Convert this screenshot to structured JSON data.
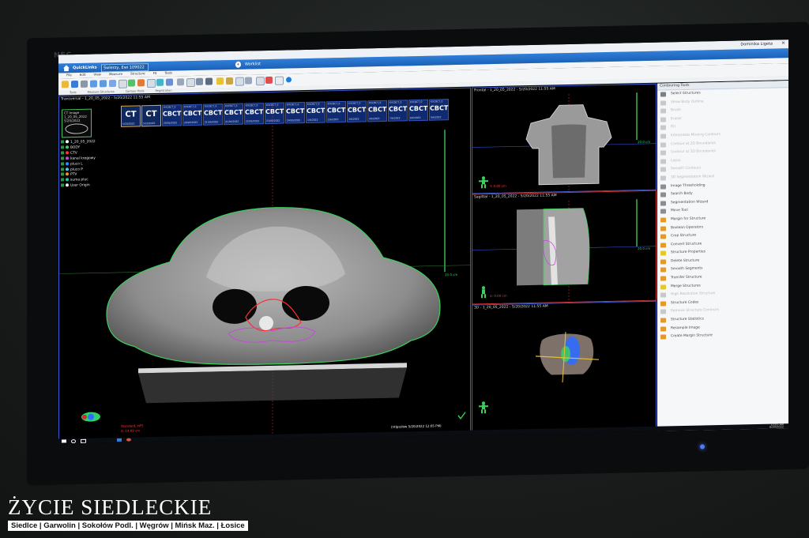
{
  "monitor": {
    "brand": "NEC"
  },
  "app": {
    "user": "Dominika Ligeta",
    "nav": {
      "quicklinks": "QuickLinks",
      "patient": "Śwlerzy, Ewi 109022",
      "workspace": "Worklist"
    },
    "menu": [
      "File",
      "Edit",
      "View",
      "Measure",
      "Structure",
      "Fit",
      "Tools"
    ],
    "subtoolbar": [
      "Tools",
      "Measure Structures",
      "Contour Tools",
      "Registration"
    ]
  },
  "panes": {
    "transverse": {
      "title": "Transversal - 1_20_05_2022 - 5/20/2022 11:55 AM",
      "scale": "20.0 cm",
      "footer": "Standard, HFS",
      "zpos": "Z: 14.69 cm",
      "timestamp": "(ntlpszlow 5/20/2022 12:05 PM)"
    },
    "frontal": {
      "title": "Frontal - 1_20_05_2022 - 5/20/2022 11:55 AM",
      "scale": "20.0 cm",
      "ypos": "Y: 0.00 cm"
    },
    "sagittal": {
      "title": "Sagittal - 1_20_05_2022 - 5/20/2022 11:55 AM",
      "scale": "20.0 cm",
      "xpos": "X: 0.00 cm"
    },
    "view3d": {
      "title": "3D - 1_20_05_2022 - 5/20/2022 11:55 AM"
    }
  },
  "image_tree": {
    "thumb_title": "CT Image",
    "thumb_sub": "1_20_05_2022",
    "thumb_date": "5/20/2022",
    "structures": [
      {
        "name": "1_20_05_2022",
        "color": "#ffffff"
      },
      {
        "name": "BODY",
        "color": "#3bd15a"
      },
      {
        "name": "CTV",
        "color": "#ff3030"
      },
      {
        "name": "kanal kregowy",
        "color": "#c34bd8"
      },
      {
        "name": "pluco L",
        "color": "#2f8fff"
      },
      {
        "name": "pluco P",
        "color": "#4bc1ff"
      },
      {
        "name": "PTV",
        "color": "#ff8a1a"
      },
      {
        "name": "suma pluc",
        "color": "#19c6b5"
      },
      {
        "name": "User Origin",
        "color": "#eeeeee"
      }
    ]
  },
  "strip": [
    {
      "top": "",
      "label": "CT",
      "date": "5/20/2022",
      "kind": "ct"
    },
    {
      "top": "",
      "label": "CT",
      "date": "5/20/2022",
      "kind": "ct"
    },
    {
      "top": "KVCBCT_0",
      "label": "CBCT",
      "date": "20/05/2022",
      "kind": "cbct"
    },
    {
      "top": "KVCBCT_0",
      "label": "CBCT",
      "date": "20/05/2022",
      "kind": "cbct"
    },
    {
      "top": "KVCBCT_0",
      "label": "CBCT",
      "date": "21/05/2022",
      "kind": "cbct"
    },
    {
      "top": "KVCBCT_0",
      "label": "CBCT",
      "date": "21/05/2022",
      "kind": "cbct"
    },
    {
      "top": "KVCBCT_0",
      "label": "CBCT",
      "date": "22/05/2022",
      "kind": "cbct"
    },
    {
      "top": "KVCBCT_0",
      "label": "CBCT",
      "date": "23/05/2022",
      "kind": "cbct"
    },
    {
      "top": "KVCBCT_0",
      "label": "CBCT",
      "date": "24/05/2022",
      "kind": "cbct"
    },
    {
      "top": "KVCBCT_0",
      "label": "CBCT",
      "date": "1/6/2022",
      "kind": "cbct"
    },
    {
      "top": "KVCBCT_0",
      "label": "CBCT",
      "date": "2/6/2022",
      "kind": "cbct"
    },
    {
      "top": "KVCBCT_0",
      "label": "CBCT",
      "date": "3/6/2022",
      "kind": "cbct"
    },
    {
      "top": "KVCBCT_0",
      "label": "CBCT",
      "date": "4/6/2022",
      "kind": "cbct"
    },
    {
      "top": "KVCBCT_0",
      "label": "CBCT",
      "date": "7/6/2022",
      "kind": "cbct"
    },
    {
      "top": "KVCBCT_0",
      "label": "CBCT",
      "date": "8/6/2022",
      "kind": "cbct"
    },
    {
      "top": "KVCBCT_0",
      "label": "CBCT",
      "date": "9/6/2022",
      "kind": "cbct"
    }
  ],
  "tools_panel": {
    "title": "Contouring Tools",
    "items": [
      {
        "label": "Select Structures",
        "enabled": true,
        "color": "#7c7f85"
      },
      {
        "label": "Show Body Outline",
        "enabled": false,
        "color": "#c7c9cc"
      },
      {
        "label": "Brush",
        "enabled": false,
        "color": "#c7c9cc"
      },
      {
        "label": "Eraser",
        "enabled": false,
        "color": "#c7c9cc"
      },
      {
        "label": "Fill",
        "enabled": false,
        "color": "#c7c9cc"
      },
      {
        "label": "Interpolate Missing Contours",
        "enabled": false,
        "color": "#c7c9cc"
      },
      {
        "label": "Contour at 2D Boundaries",
        "enabled": false,
        "color": "#c7c9cc"
      },
      {
        "label": "Contour at 3D Boundaries",
        "enabled": false,
        "color": "#c7c9cc"
      },
      {
        "label": "Lasso",
        "enabled": false,
        "color": "#c7c9cc"
      },
      {
        "label": "Smooth Contours",
        "enabled": false,
        "color": "#c7c9cc"
      },
      {
        "label": "3D Segmentation Wizard",
        "enabled": false,
        "color": "#c7c9cc"
      },
      {
        "label": "Image Thresholding",
        "enabled": true,
        "color": "#8a8d92"
      },
      {
        "label": "Search Body",
        "enabled": true,
        "color": "#8a8d92"
      },
      {
        "label": "Segmentation Wizard",
        "enabled": true,
        "color": "#8a8d92"
      },
      {
        "label": "Move Tool",
        "enabled": true,
        "color": "#8a8d92"
      },
      {
        "label": "Margin for Structure",
        "enabled": true,
        "color": "#e49a2a"
      },
      {
        "label": "Boolean Operators",
        "enabled": true,
        "color": "#e49a2a"
      },
      {
        "label": "Crop Structure",
        "enabled": true,
        "color": "#e49a2a"
      },
      {
        "label": "Convert Structure",
        "enabled": true,
        "color": "#e49a2a"
      },
      {
        "label": "Structure Properties",
        "enabled": true,
        "color": "#e4c92a"
      },
      {
        "label": "Delete Structure",
        "enabled": true,
        "color": "#e49a2a"
      },
      {
        "label": "Smooth Segments",
        "enabled": true,
        "color": "#e49a2a"
      },
      {
        "label": "Transfer Structure",
        "enabled": true,
        "color": "#e49a2a"
      },
      {
        "label": "Merge Structures",
        "enabled": true,
        "color": "#e4c92a"
      },
      {
        "label": "High Resolution Structure",
        "enabled": false,
        "color": "#c7c9cc"
      },
      {
        "label": "Structure Codes",
        "enabled": true,
        "color": "#e49a2a"
      },
      {
        "label": "Remove Structure Contours",
        "enabled": false,
        "color": "#c7c9cc"
      },
      {
        "label": "Structure Statistics",
        "enabled": true,
        "color": "#e49a2a"
      },
      {
        "label": "Resample Image",
        "enabled": true,
        "color": "#e49a2a"
      },
      {
        "label": "Create Margin Structure",
        "enabled": true,
        "color": "#e49a2a"
      }
    ]
  },
  "taskbar": {
    "time": "10:05 AM",
    "date": "6/20/2022"
  },
  "watermark": {
    "title": "ŻYCIE SIEDLECKIE",
    "subtitle": "Siedlce | Garwolin | Sokołów Podl. | Węgrów | Mińsk Maz. | Łosice"
  }
}
